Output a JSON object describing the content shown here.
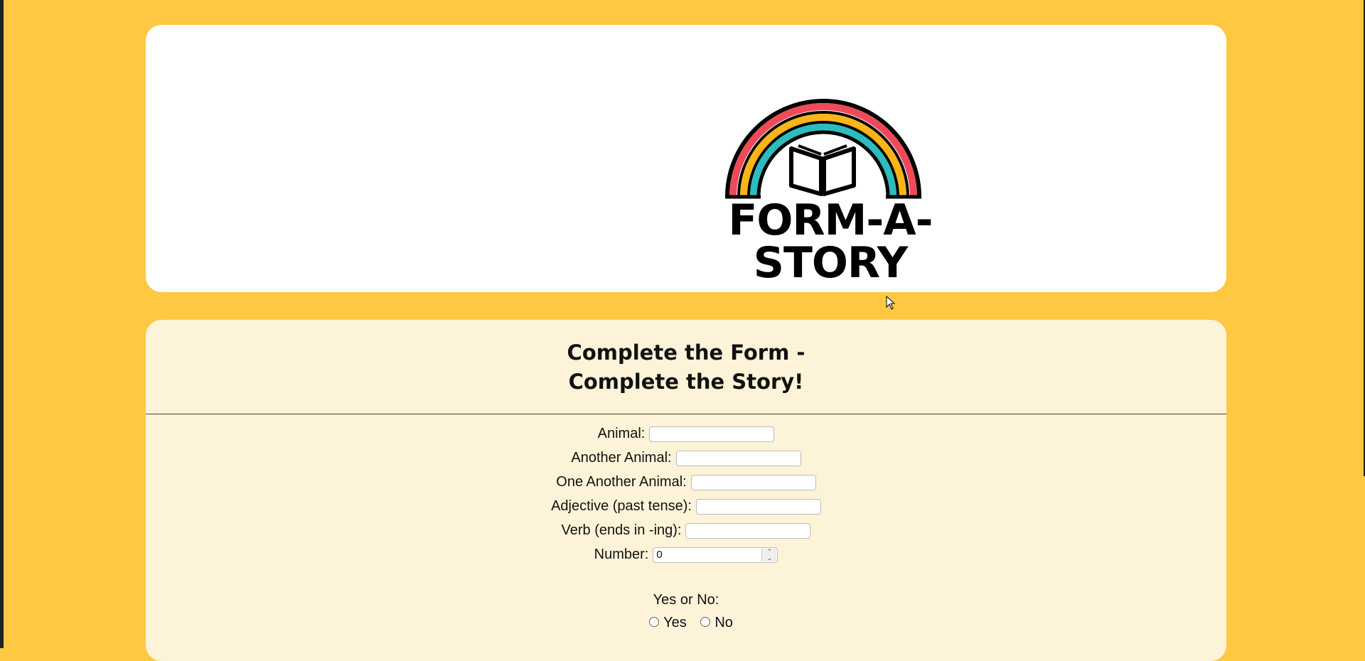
{
  "header": {
    "logo_text": "FORM-A-STORY"
  },
  "form": {
    "title_line1": "Complete the Form -",
    "title_line2": "Complete the Story!",
    "fields": [
      {
        "label": "Animal:",
        "value": ""
      },
      {
        "label": "Another Animal:",
        "value": ""
      },
      {
        "label": "One Another Animal:",
        "value": ""
      },
      {
        "label": "Adjective (past tense):",
        "value": ""
      },
      {
        "label": "Verb (ends in -ing):",
        "value": ""
      },
      {
        "label": "Number:",
        "value": "0"
      }
    ],
    "yes_no_label": "Yes or No:",
    "options": [
      "Yes",
      "No"
    ]
  },
  "colors": {
    "background": "#ffc843",
    "header_card": "#ffffff",
    "form_card": "#fdf3d8",
    "rainbow_red": "#ee4a5a",
    "rainbow_yellow": "#fbb516",
    "rainbow_teal": "#2cbcbe"
  }
}
